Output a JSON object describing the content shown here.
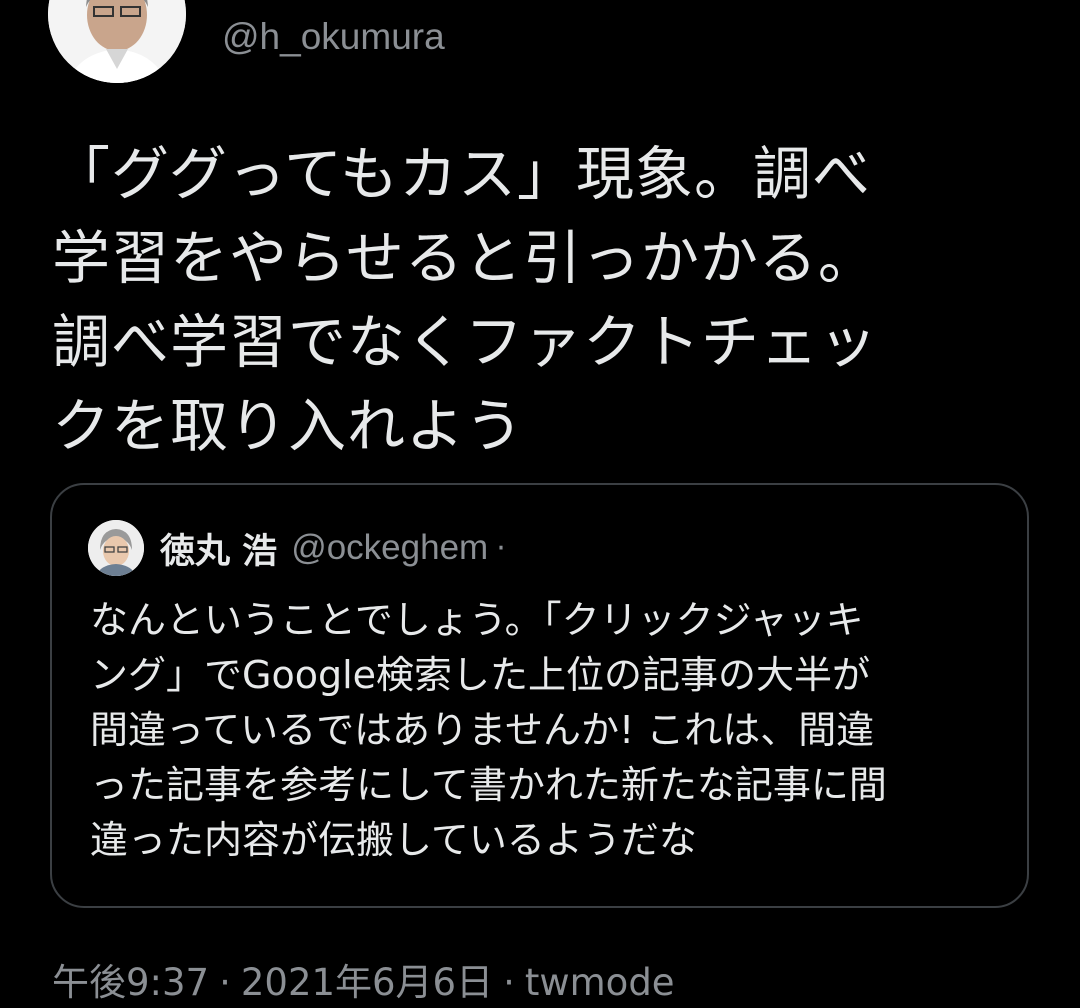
{
  "tweet": {
    "handle": "@h_okumura",
    "text": "「ググってもカス」現象。調べ\n学習をやらせると引っかかる。\n調べ学習でなくファクトチェッ\nクを取り入れよう",
    "avatar_icon": "user-photo-avatar"
  },
  "quote": {
    "name": "徳丸 浩",
    "handle": "@ockeghem",
    "dot": "·",
    "text": "なんということでしょう。「クリックジャッキ\nング」でGoogle検索した上位の記事の大半が\n間違っているではありませんか! これは、間違\nった記事を参考にして書かれた新たな記事に間\n違った内容が伝搬しているようだな",
    "avatar_icon": "user-illustration-avatar"
  },
  "meta": {
    "time": "午後9:37",
    "sep1": "·",
    "date": "2021年6月6日",
    "sep2": "·",
    "source": "twmode"
  },
  "colors": {
    "background": "#000000",
    "text": "#e7e9ea",
    "secondary": "#8b8f94",
    "border": "#3b3f43"
  }
}
